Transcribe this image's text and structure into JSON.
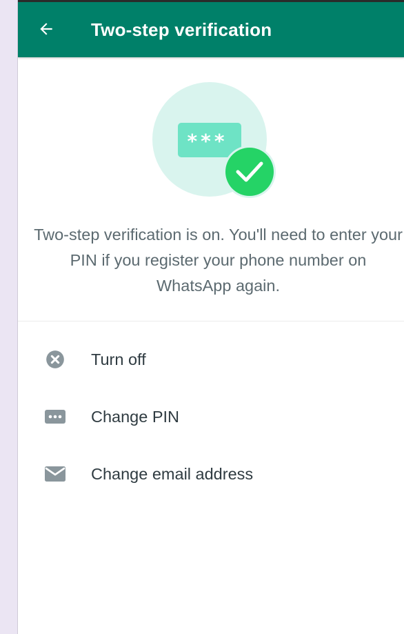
{
  "appbar": {
    "title": "Two-step verification",
    "back_icon": "arrow-left-icon",
    "color": "#008069"
  },
  "illustration": {
    "masked_pin": "***",
    "icon": "check-circle-icon",
    "accent": "#25d366"
  },
  "message": "Two-step verification is on. You'll need to enter your PIN if you register your phone number on WhatsApp again.",
  "options": [
    {
      "label": "Turn off",
      "icon": "close-circle-icon"
    },
    {
      "label": "Change PIN",
      "icon": "pin-dots-icon"
    },
    {
      "label": "Change email address",
      "icon": "email-icon"
    }
  ]
}
